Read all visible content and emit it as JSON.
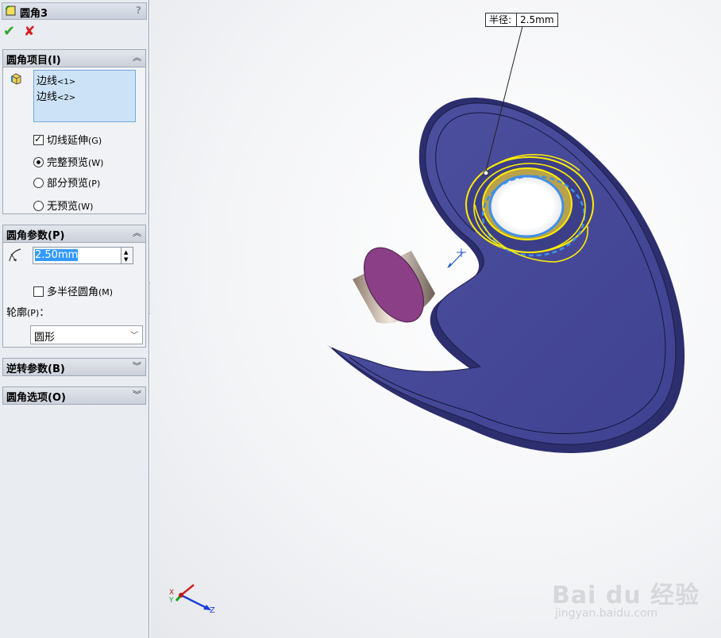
{
  "panel": {
    "title": "圆角3",
    "help": "?",
    "fillet_items": {
      "header": "圆角项目(I)",
      "edges": [
        {
          "name": "边线",
          "index": "<1>"
        },
        {
          "name": "边线",
          "index": "<2>"
        }
      ],
      "tangent_propagation": {
        "label": "切线延伸",
        "key": "(G)",
        "checked": true
      },
      "preview_options": [
        {
          "label": "完整预览",
          "key": "(W)",
          "selected": true
        },
        {
          "label": "部分预览",
          "key": "(P)",
          "selected": false
        },
        {
          "label": "无预览",
          "key": "(W)",
          "selected": false
        }
      ]
    },
    "fillet_params": {
      "header": "圆角参数(P)",
      "radius": "2.50mm",
      "multi_radius": {
        "label": "多半径圆角",
        "key": "(M)",
        "checked": false
      },
      "profile_label": "轮廓",
      "profile_key": "(P)",
      "profile_colon": "：",
      "profile_value": "圆形"
    },
    "setback_params": {
      "header": "逆转参数(B)"
    },
    "fillet_options": {
      "header": "圆角选项(O)"
    }
  },
  "viewport": {
    "callout_label": "半径:",
    "callout_value": "2.5mm",
    "triad": {
      "x": "X",
      "y": "Y",
      "z": "Z"
    },
    "watermark": {
      "logo": "Bai du 经验",
      "url": "jingyan.baidu.com"
    },
    "colors": {
      "part": "#4a4d9a",
      "highlight": "#ffee00",
      "selection": "#3f8fe8",
      "cylinder_top": "#8a3f86"
    }
  }
}
